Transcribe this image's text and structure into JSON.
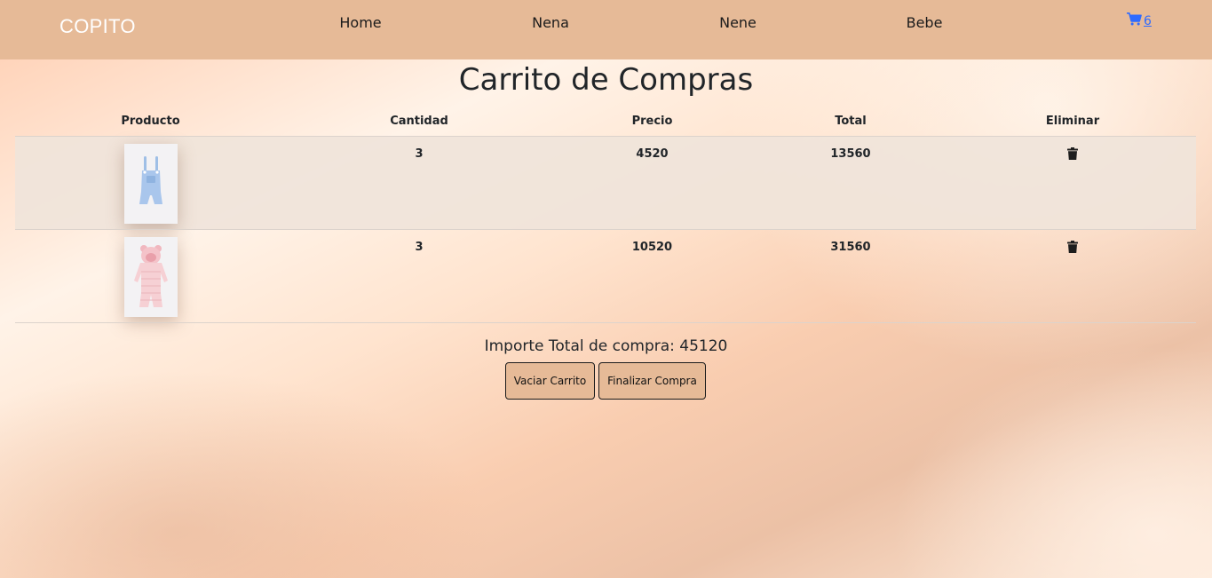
{
  "nav": {
    "brand": "COPITO",
    "links": [
      "Home",
      "Nena",
      "Nene",
      "Bebe"
    ],
    "cart_count": "6"
  },
  "page": {
    "title": "Carrito de Compras"
  },
  "table": {
    "headers": [
      "Producto",
      "Cantidad",
      "Precio",
      "Total",
      "Eliminar"
    ],
    "rows": [
      {
        "cantidad": "3",
        "precio": "4520",
        "total": "13560",
        "product_image": "blue-baby-overalls"
      },
      {
        "cantidad": "3",
        "precio": "10520",
        "total": "31560",
        "product_image": "pink-puffer-snowsuit"
      }
    ]
  },
  "summary": {
    "total_text": "Importe Total de compra: 45120"
  },
  "actions": {
    "empty_label": "Vaciar Carrito",
    "checkout_label": "Finalizar Compra"
  },
  "colors": {
    "navbar": "#e6ba97",
    "button_bg": "#e6ba97",
    "cart_link": "#2f6bff"
  }
}
